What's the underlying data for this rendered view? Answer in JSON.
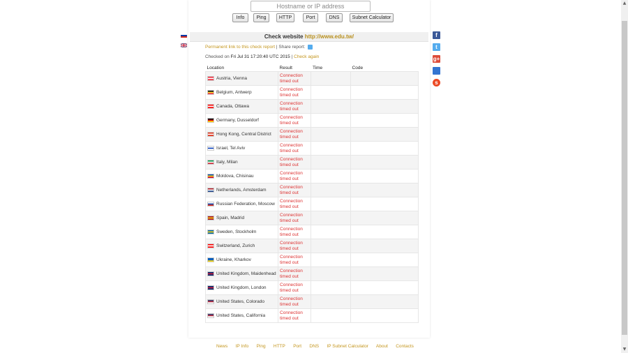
{
  "search": {
    "placeholder": "Hostname or IP address"
  },
  "nav": [
    "Info",
    "Ping",
    "HTTP",
    "Port",
    "DNS",
    "Subnet Calculator"
  ],
  "header": {
    "label": "Check website",
    "url": "http://www.edu.tw/"
  },
  "permalink": {
    "link_text": "Permanent link to this check report",
    "separator": "|",
    "share_text": "Share report:"
  },
  "checked": {
    "prefix": "Checked on",
    "datetime": "Fri Jul 31 17:20:40 UTC 2015",
    "separator": "|",
    "check_again": "Check again"
  },
  "table": {
    "headers": [
      "Location",
      "Result",
      "Time",
      "Code"
    ],
    "rows": [
      {
        "location": "Austria, Vienna",
        "result": "Connection timed out",
        "time": "",
        "code": ""
      },
      {
        "location": "Belgium, Antwerp",
        "result": "Connection timed out",
        "time": "",
        "code": ""
      },
      {
        "location": "Canada, Ottawa",
        "result": "Connection timed out",
        "time": "",
        "code": ""
      },
      {
        "location": "Germany, Dusseldorf",
        "result": "Connection timed out",
        "time": "",
        "code": ""
      },
      {
        "location": "Hong Kong, Central District",
        "result": "Connection timed out",
        "time": "",
        "code": ""
      },
      {
        "location": "Israel, Tel Aviv",
        "result": "Connection timed out",
        "time": "",
        "code": ""
      },
      {
        "location": "Italy, Milan",
        "result": "Connection timed out",
        "time": "",
        "code": ""
      },
      {
        "location": "Moldova, Chisinau",
        "result": "Connection timed out",
        "time": "",
        "code": ""
      },
      {
        "location": "Netherlands, Amsterdam",
        "result": "Connection timed out",
        "time": "",
        "code": ""
      },
      {
        "location": "Russian Federation, Moscow",
        "result": "Connection timed out",
        "time": "",
        "code": ""
      },
      {
        "location": "Spain, Madrid",
        "result": "Connection timed out",
        "time": "",
        "code": ""
      },
      {
        "location": "Sweden, Stockholm",
        "result": "Connection timed out",
        "time": "",
        "code": ""
      },
      {
        "location": "Switzerland, Zurich",
        "result": "Connection timed out",
        "time": "",
        "code": ""
      },
      {
        "location": "Ukraine, Kharkov",
        "result": "Connection timed out",
        "time": "",
        "code": ""
      },
      {
        "location": "United Kingdom, Maidenhead",
        "result": "Connection timed out",
        "time": "",
        "code": ""
      },
      {
        "location": "United Kingdom, London",
        "result": "Connection timed out",
        "time": "",
        "code": ""
      },
      {
        "location": "United States, Colorado",
        "result": "Connection timed out",
        "time": "",
        "code": ""
      },
      {
        "location": "United States, California",
        "result": "Connection timed out",
        "time": "",
        "code": ""
      }
    ]
  },
  "flags": [
    [
      "#ed2939",
      "#ffffff",
      "#ed2939"
    ],
    [
      "#000000",
      "#fdda24",
      "#ef3340"
    ],
    [
      "#ff0000",
      "#ffffff",
      "#ff0000"
    ],
    [
      "#000000",
      "#dd0000",
      "#ffce00"
    ],
    [
      "#de2910",
      "#ffffff",
      "#de2910"
    ],
    [
      "#ffffff",
      "#0038b8",
      "#ffffff"
    ],
    [
      "#009246",
      "#ffffff",
      "#ce2b37"
    ],
    [
      "#0046ae",
      "#ffd200",
      "#cc092f"
    ],
    [
      "#ae1c28",
      "#ffffff",
      "#21468b"
    ],
    [
      "#ffffff",
      "#0039a6",
      "#d52b1e"
    ],
    [
      "#aa151b",
      "#f1bf00",
      "#aa151b"
    ],
    [
      "#006aa7",
      "#fecc00",
      "#006aa7"
    ],
    [
      "#ff0000",
      "#ffffff",
      "#ff0000"
    ],
    [
      "#0057b7",
      "#0057b7",
      "#ffd700"
    ],
    [
      "#012169",
      "#c8102e",
      "#012169"
    ],
    [
      "#012169",
      "#c8102e",
      "#012169"
    ],
    [
      "#3c3b6e",
      "#b22234",
      "#ffffff"
    ],
    [
      "#3c3b6e",
      "#b22234",
      "#ffffff"
    ]
  ],
  "social": [
    {
      "icon": "facebook-icon",
      "glyph": "f",
      "color": "#3b5998"
    },
    {
      "icon": "twitter-icon",
      "glyph": "t",
      "color": "#55acee"
    },
    {
      "icon": "google-plus-icon",
      "glyph": "g+",
      "color": "#dd4b39"
    },
    {
      "icon": "delicious-icon",
      "glyph": "",
      "color": "#3274d1"
    },
    {
      "icon": "stumbleupon-icon",
      "glyph": "s",
      "color": "#eb4924"
    }
  ],
  "footer": [
    "News",
    "IP Info",
    "Ping",
    "HTTP",
    "Port",
    "DNS",
    "IP Subnet Calculator",
    "About",
    "Contacts"
  ],
  "colors": {
    "link": "#c4961e",
    "error": "#dd3333",
    "header_bg": "#f0f0f0"
  }
}
